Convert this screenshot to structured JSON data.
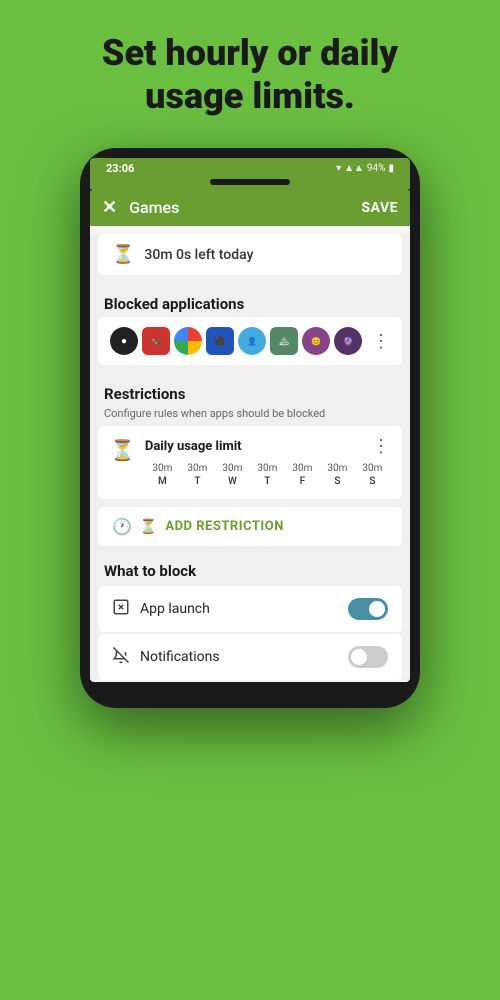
{
  "hero": {
    "line1": "Set hourly or daily",
    "line2": "usage limits."
  },
  "status_bar": {
    "time": "23:06",
    "battery": "94%"
  },
  "toolbar": {
    "title": "Games",
    "save_label": "SAVE"
  },
  "timer_banner": {
    "text": "30m 0s left today"
  },
  "blocked_apps": {
    "section_title": "Blocked applications"
  },
  "restrictions": {
    "section_title": "Restrictions",
    "section_sub": "Configure rules when apps should be blocked",
    "rule_title": "Daily usage limit",
    "days": [
      "M",
      "T",
      "W",
      "T",
      "F",
      "S",
      "S"
    ],
    "limits": [
      "30m",
      "30m",
      "30m",
      "30m",
      "30m",
      "30m",
      "30m"
    ]
  },
  "add_restriction": {
    "label": "ADD RESTRICTION"
  },
  "what_to_block": {
    "title": "What to block",
    "options": [
      {
        "label": "App launch",
        "toggle": "on"
      },
      {
        "label": "Notifications",
        "toggle": "off"
      }
    ]
  }
}
